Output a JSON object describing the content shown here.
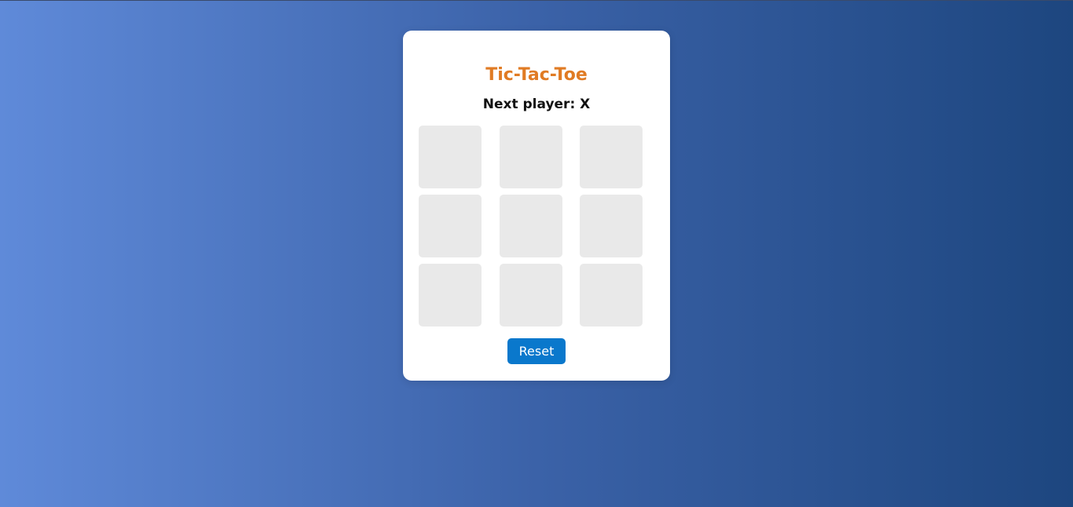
{
  "game": {
    "title": "Tic-Tac-Toe",
    "status": "Next player: X",
    "board": [
      "",
      "",
      "",
      "",
      "",
      "",
      "",
      "",
      ""
    ],
    "reset_label": "Reset"
  },
  "colors": {
    "title": "#e07b24",
    "reset_button": "#0a78cc",
    "cell": "#e9e9e9",
    "card": "#ffffff"
  }
}
